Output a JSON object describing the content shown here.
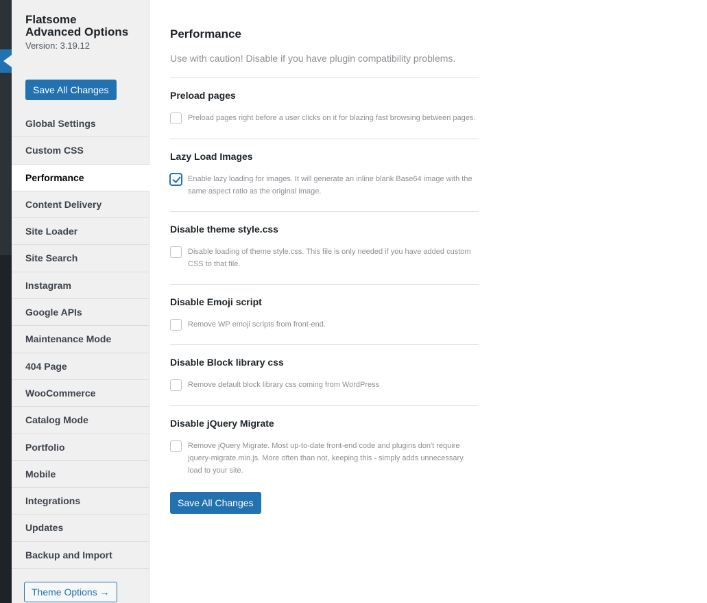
{
  "sidebar": {
    "brand_line1": "Flatsome",
    "brand_line2": "Advanced Options",
    "version": "Version: 3.19.12",
    "save_label": "Save All Changes",
    "items": [
      {
        "label": "Global Settings"
      },
      {
        "label": "Custom CSS"
      },
      {
        "label": "Performance",
        "active": true
      },
      {
        "label": "Content Delivery"
      },
      {
        "label": "Site Loader"
      },
      {
        "label": "Site Search"
      },
      {
        "label": "Instagram"
      },
      {
        "label": "Google APIs"
      },
      {
        "label": "Maintenance Mode"
      },
      {
        "label": "404 Page"
      },
      {
        "label": "WooCommerce"
      },
      {
        "label": "Catalog Mode"
      },
      {
        "label": "Portfolio"
      },
      {
        "label": "Mobile"
      },
      {
        "label": "Integrations"
      },
      {
        "label": "Updates"
      },
      {
        "label": "Backup and Import"
      }
    ],
    "theme_options_label": "Theme Options →"
  },
  "main": {
    "title": "Performance",
    "description": "Use with caution! Disable if you have plugin compatibility problems.",
    "options": [
      {
        "title": "Preload pages",
        "checked": false,
        "text": "Preload pages right before a user clicks on it for blazing fast browsing between pages."
      },
      {
        "title": "Lazy Load Images",
        "checked": true,
        "text": "Enable lazy loading for images. It will generate an inline blank Base64 image with the same aspect ratio as the original image."
      },
      {
        "title": "Disable theme style.css",
        "checked": false,
        "text": "Disable loading of theme style.css. This file is only needed if you have added custom CSS to that file."
      },
      {
        "title": "Disable Emoji script",
        "checked": false,
        "text": "Remove WP emoji scripts from front-end."
      },
      {
        "title": "Disable Block library css",
        "checked": false,
        "text": "Remove default block library css coming from WordPress"
      },
      {
        "title": "Disable jQuery Migrate",
        "checked": false,
        "text": "Remove jQuery Migrate. Most up-to-date front-end code and plugins don't require jquery-migrate.min.js. More often than not, keeping this - simply adds unnecessary load to your site."
      }
    ],
    "save_label": "Save All Changes"
  },
  "colors": {
    "accent": "#2271b1",
    "admin_bar": "#1d2327",
    "sidebar_bg": "#f0f0f1"
  }
}
